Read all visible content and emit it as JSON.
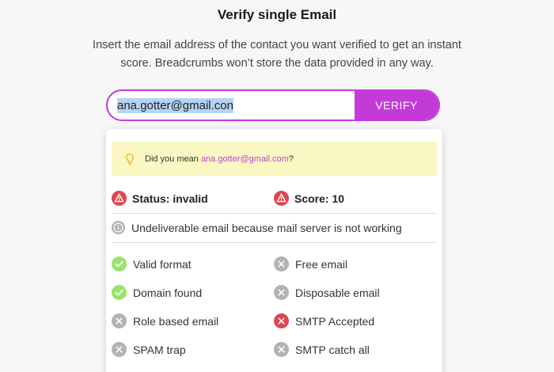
{
  "page": {
    "title": "Verify single Email",
    "subtitle": "Insert the email address of the contact you want verified to get an instant score. Breadcrumbs won’t store the data provided in any way."
  },
  "form": {
    "email_value": "ana.gotter@gmail.con",
    "verify_label": "VERIFY",
    "accent_color": "#c33ad8"
  },
  "result": {
    "suggestion_prefix": "Did you mean ",
    "suggestion_email": "ana.gotter@gmail.com",
    "suggestion_suffix": "?",
    "status_label": "Status: invalid",
    "score_label": "Score: 10",
    "reason": "Undeliverable email because mail server is not working",
    "checks": [
      {
        "label": "Valid format",
        "state": "pass",
        "icon": "check-icon"
      },
      {
        "label": "Free email",
        "state": "neutral",
        "icon": "x-icon"
      },
      {
        "label": "Domain found",
        "state": "pass",
        "icon": "check-icon"
      },
      {
        "label": "Disposable email",
        "state": "neutral",
        "icon": "x-icon"
      },
      {
        "label": "Role based email",
        "state": "neutral",
        "icon": "x-icon"
      },
      {
        "label": "SMTP Accepted",
        "state": "fail",
        "icon": "x-icon"
      },
      {
        "label": "SPAM trap",
        "state": "neutral",
        "icon": "x-icon"
      },
      {
        "label": "SMTP catch all",
        "state": "neutral",
        "icon": "x-icon"
      }
    ],
    "colors": {
      "pass": "#9be36a",
      "fail": "#e0464f",
      "neutral": "#b3b3b3",
      "warning": "#e0464f",
      "suggestion_bg": "#fbf7c2"
    }
  }
}
